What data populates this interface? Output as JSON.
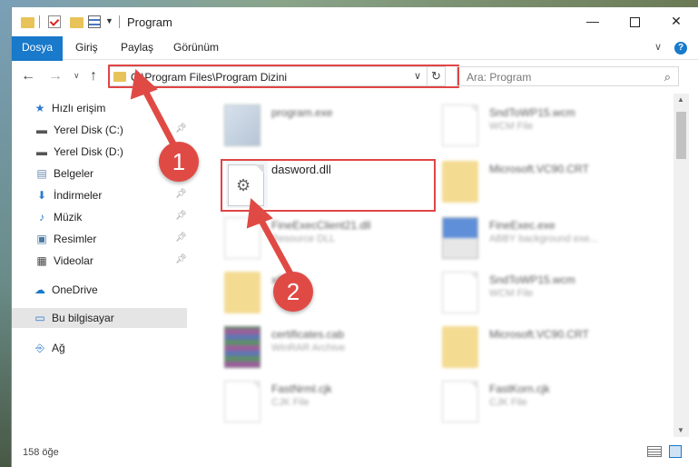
{
  "window": {
    "title": "Program"
  },
  "ribbon": {
    "tabs": [
      "Dosya",
      "Giriş",
      "Paylaş",
      "Görünüm"
    ]
  },
  "address": {
    "path": "C:\\Program Files\\Program Dizini"
  },
  "search": {
    "placeholder": "Ara: Program"
  },
  "nav": {
    "quick_access": "Hızlı erişim",
    "items": [
      {
        "label": "Yerel Disk (C:)",
        "icon": "drive-icon",
        "pinned": true
      },
      {
        "label": "Yerel Disk (D:)",
        "icon": "drive-icon",
        "pinned": false
      },
      {
        "label": "Belgeler",
        "icon": "documents-icon",
        "pinned": false
      },
      {
        "label": "İndirmeler",
        "icon": "download-icon",
        "pinned": true
      },
      {
        "label": "Müzik",
        "icon": "music-icon",
        "pinned": true
      },
      {
        "label": "Resimler",
        "icon": "pictures-icon",
        "pinned": true
      },
      {
        "label": "Videolar",
        "icon": "videos-icon",
        "pinned": true
      }
    ],
    "onedrive": "OneDrive",
    "this_pc": "Bu bilgisayar",
    "network": "Ağ"
  },
  "files": [
    {
      "name": "program.exe",
      "type": ""
    },
    {
      "name": "SndToWP15.wcm",
      "type": "WCM File"
    },
    {
      "name": "dasword.dll",
      "type": ""
    },
    {
      "name": "Microsoft.VC90.CRT",
      "type": ""
    },
    {
      "name": "FineExecClient21.dll",
      "type": "Resource DLL"
    },
    {
      "name": "FineExec.exe",
      "type": "ABBY background exe..."
    },
    {
      "name": "x64",
      "type": ""
    },
    {
      "name": "SndToWP15.wcm",
      "type": "WCM File"
    },
    {
      "name": "certificates.cab",
      "type": "WinRAR Archive"
    },
    {
      "name": "Microsoft.VC90.CRT",
      "type": ""
    },
    {
      "name": "FastNrml.cjk",
      "type": "CJK File"
    },
    {
      "name": "FastKorn.cjk",
      "type": "CJK File"
    }
  ],
  "status": {
    "count": "158 öğe"
  },
  "annotations": {
    "marker1": "1",
    "marker2": "2"
  },
  "colors": {
    "accent": "#1979ca",
    "annotation": "#e04545"
  }
}
